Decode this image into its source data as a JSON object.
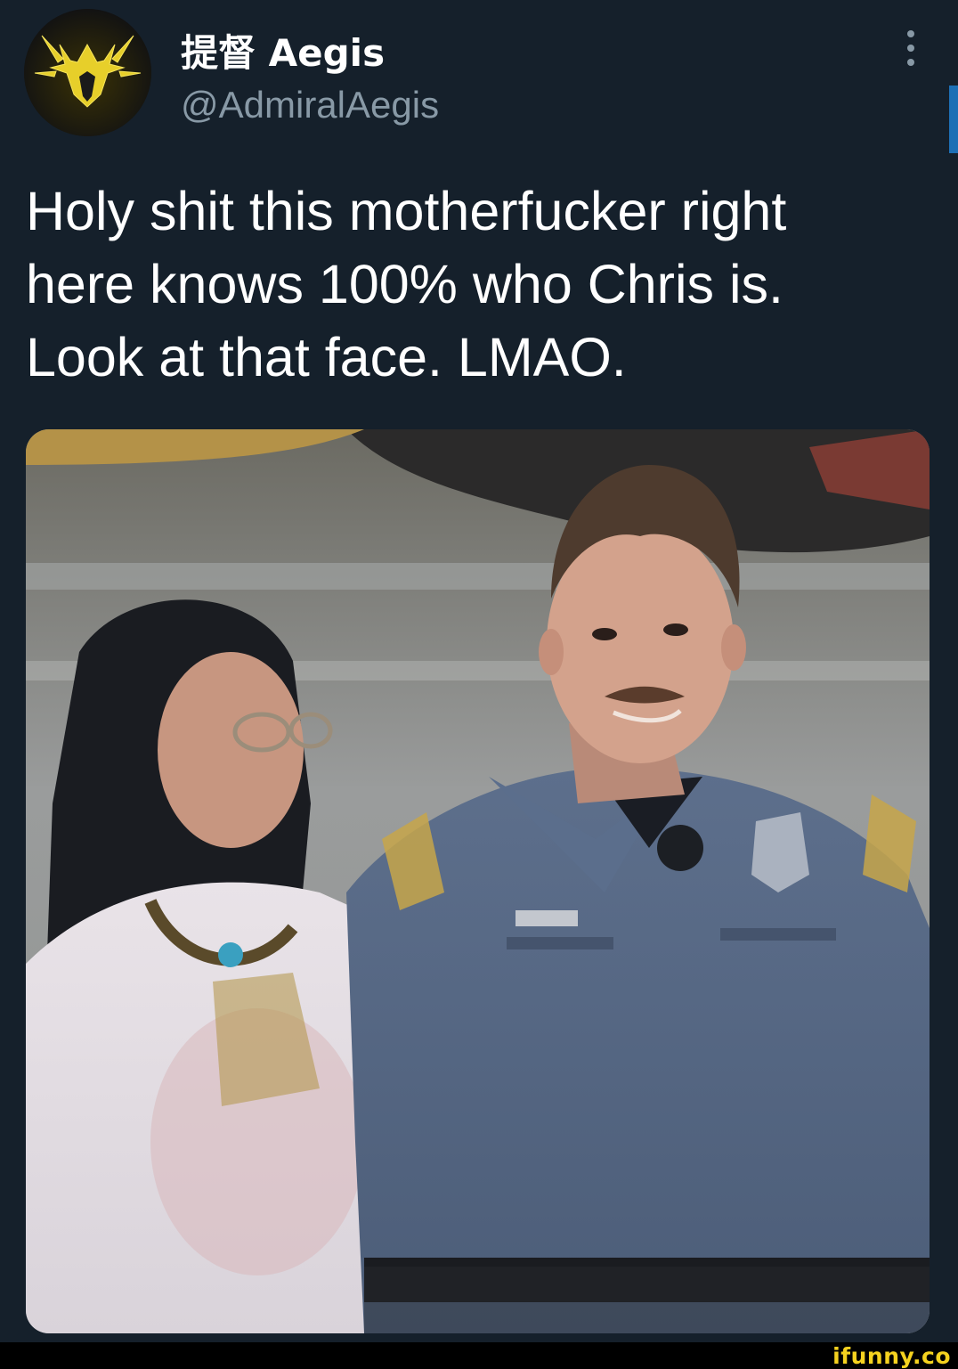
{
  "tweet": {
    "display_name": "提督 Aegis",
    "handle": "@AdmiralAegis",
    "text": "Holy shit this motherfucker right\nhere knows 100% who Chris is.\nLook at that face. LMAO.",
    "avatar_icon": "yellow-crest-emblem-icon",
    "more_icon": "vertical-ellipsis-icon"
  },
  "watermark": {
    "text": "ifunny.co",
    "color": "#f5d21f"
  },
  "colors": {
    "background": "#15202b",
    "text": "#ffffff",
    "muted": "#8899a6",
    "accent": "#1d6fb5"
  }
}
